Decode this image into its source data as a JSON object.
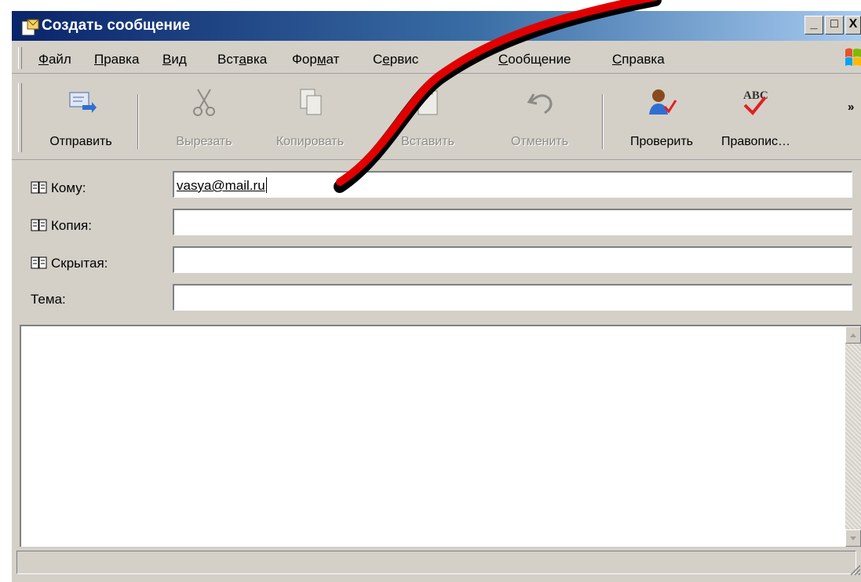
{
  "window": {
    "title": "Создать сообщение"
  },
  "caption_buttons": {
    "minimize": "_",
    "maximize": "□",
    "close": "X"
  },
  "menu": [
    {
      "pre": "",
      "key": "Ф",
      "post": "айл"
    },
    {
      "pre": "",
      "key": "П",
      "post": "равка"
    },
    {
      "pre": "",
      "key": "В",
      "post": "ид"
    },
    {
      "pre": "Вст",
      "key": "а",
      "post": "вка"
    },
    {
      "pre": "Фор",
      "key": "м",
      "post": "ат"
    },
    {
      "pre": "С",
      "key": "е",
      "post": "рвис"
    },
    {
      "pre": "",
      "key": "С",
      "post": "ообщение"
    },
    {
      "pre": "",
      "key": "С",
      "post": "правка"
    }
  ],
  "toolbar": {
    "send": "Отправить",
    "cut": "Вырезать",
    "copy": "Копировать",
    "paste": "Вставить",
    "undo": "Отменить",
    "check": "Проверить",
    "spelling": "Правопис…",
    "spelling_icon_text": "ABC",
    "more": "»"
  },
  "fields": {
    "to_label": "Кому:",
    "to_value": "vasya@mail.ru",
    "cc_label": "Копия:",
    "cc_value": "",
    "bcc_label": "Скрытая:",
    "bcc_value": "",
    "subject_label": "Тема:",
    "subject_value": ""
  },
  "body": {
    "text": ""
  },
  "colors": {
    "title_start": "#0a246a",
    "title_end": "#a6caf0",
    "chrome": "#d4d0c8",
    "annotation_red": "#e00000"
  },
  "icons": [
    "new-message-icon",
    "send-icon",
    "cut-icon",
    "copy-icon",
    "paste-icon",
    "undo-icon",
    "check-names-icon",
    "spelling-icon",
    "address-book-icon",
    "windows-logo-icon"
  ]
}
